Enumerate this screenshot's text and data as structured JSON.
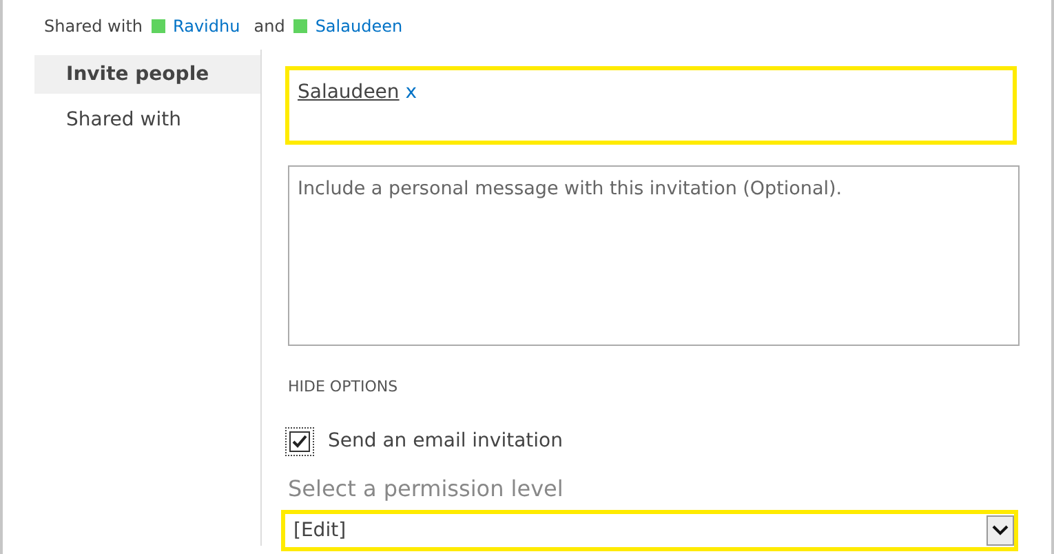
{
  "shared_with": {
    "label": "Shared with",
    "conjunction": "and",
    "people": [
      {
        "name": "Ravidhu",
        "color": "#5fd35f"
      },
      {
        "name": "Salaudeen",
        "color": "#5fd35f"
      }
    ]
  },
  "sidebar": {
    "items": [
      {
        "label": "Invite people",
        "selected": true
      },
      {
        "label": "Shared with",
        "selected": false
      }
    ]
  },
  "invite": {
    "focused": true,
    "people": [
      {
        "name": "Salaudeen",
        "remove": "x"
      }
    ]
  },
  "message": {
    "placeholder": "Include a personal message with this invitation (Optional)."
  },
  "options_toggle": "HIDE OPTIONS",
  "email_invitation": {
    "label": "Send an email invitation",
    "checked": true
  },
  "permission": {
    "label": "Select a permission level",
    "value": "[Edit]",
    "focused": true
  }
}
